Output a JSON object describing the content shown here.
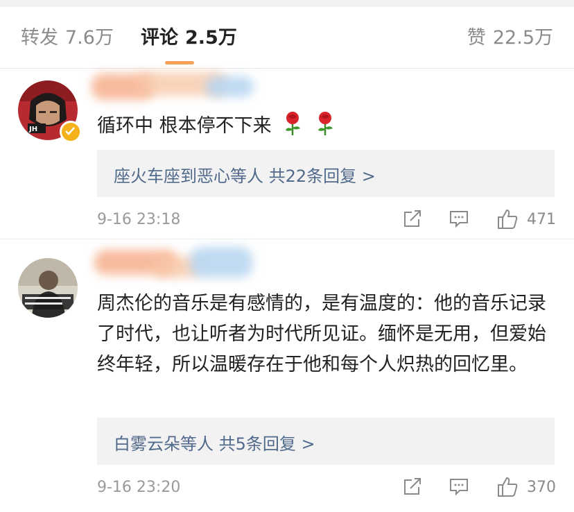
{
  "tabs": {
    "repost": {
      "label": "转发",
      "count": "7.6万"
    },
    "comment": {
      "label": "评论",
      "count": "2.5万"
    },
    "like": {
      "label": "赞",
      "count": "22.5万"
    }
  },
  "colors": {
    "accent": "#f5a15b",
    "link": "#516a8c",
    "muted": "#9a9a9a",
    "verified_badge": "#f4b21c"
  },
  "comments": [
    {
      "text": "循环中 根本停不下来",
      "emoji": [
        "rose-icon",
        "rose-icon"
      ],
      "replies": {
        "text": "座火车座到恶心等人 共22条回复 >"
      },
      "time": "9-16 23:18",
      "likes": "471",
      "verified": true
    },
    {
      "text": "周杰伦的音乐是有感情的，是有温度的：他的音乐记录了时代，也让听者为时代所见证。缅怀是无用，但爱始终年轻，所以温暖存在于他和每个人炽热的回忆里。",
      "replies": {
        "text": "白雾云朵等人 共5条回复 >"
      },
      "time": "9-16 23:20",
      "likes": "370",
      "verified": false
    }
  ]
}
